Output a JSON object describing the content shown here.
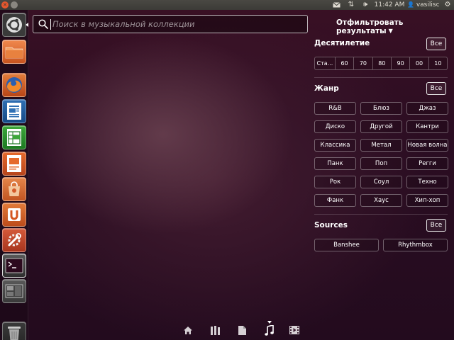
{
  "top_panel": {
    "time": "11:42 AM",
    "username": "vasilisc"
  },
  "icons": {
    "close": "close-icon",
    "maximize": "maximize-icon",
    "mail": "mail-icon",
    "network": "network-arrows-icon",
    "volume": "volume-icon",
    "user": "user-icon",
    "session": "gear-icon",
    "search": "search-icon"
  },
  "launcher": {
    "items": [
      {
        "name": "dash-home",
        "icon": "ubuntu-logo-icon"
      },
      {
        "name": "home-folder",
        "icon": "folder-icon"
      },
      {
        "name": "firefox",
        "icon": "firefox-icon"
      },
      {
        "name": "libreoffice-writer",
        "icon": "writer-icon"
      },
      {
        "name": "libreoffice-calc",
        "icon": "calc-icon"
      },
      {
        "name": "libreoffice-impress",
        "icon": "impress-icon"
      },
      {
        "name": "software-center",
        "icon": "shopping-bag-icon"
      },
      {
        "name": "ubuntu-one",
        "icon": "ubuntu-one-icon"
      },
      {
        "name": "system-settings",
        "icon": "wrench-icon"
      },
      {
        "name": "terminal",
        "icon": "terminal-icon"
      },
      {
        "name": "workspace-switcher",
        "icon": "workspaces-icon"
      },
      {
        "name": "trash",
        "icon": "trash-icon"
      }
    ]
  },
  "search": {
    "placeholder": "Поиск в музыкальной коллекции",
    "value": ""
  },
  "filters": {
    "toggle_label": "Отфильтровать результаты",
    "decade": {
      "title": "Десятилетие",
      "all_label": "Все",
      "options": [
        "Ста...",
        "60",
        "70",
        "80",
        "90",
        "00",
        "10"
      ]
    },
    "genre": {
      "title": "Жанр",
      "all_label": "Все",
      "options": [
        "R&B",
        "Блюз",
        "Джаз",
        "Диско",
        "Другой",
        "Кантри",
        "Классика",
        "Метал",
        "Новая волна",
        "Панк",
        "Поп",
        "Регги",
        "Рок",
        "Соул",
        "Техно",
        "Фанк",
        "Хаус",
        "Хип-хоп"
      ]
    },
    "sources": {
      "title": "Sources",
      "all_label": "Все",
      "options": [
        "Banshee",
        "Rhythmbox"
      ]
    }
  },
  "lenses": [
    {
      "name": "home",
      "icon": "home-icon",
      "active": false
    },
    {
      "name": "applications",
      "icon": "applications-icon",
      "active": false
    },
    {
      "name": "files",
      "icon": "file-icon",
      "active": false
    },
    {
      "name": "music",
      "icon": "music-note-icon",
      "active": true
    },
    {
      "name": "video",
      "icon": "video-icon",
      "active": false
    }
  ],
  "colors": {
    "accent_orange": "#e4572e",
    "background": "#2a0f22",
    "panel": "#3c3b37"
  }
}
